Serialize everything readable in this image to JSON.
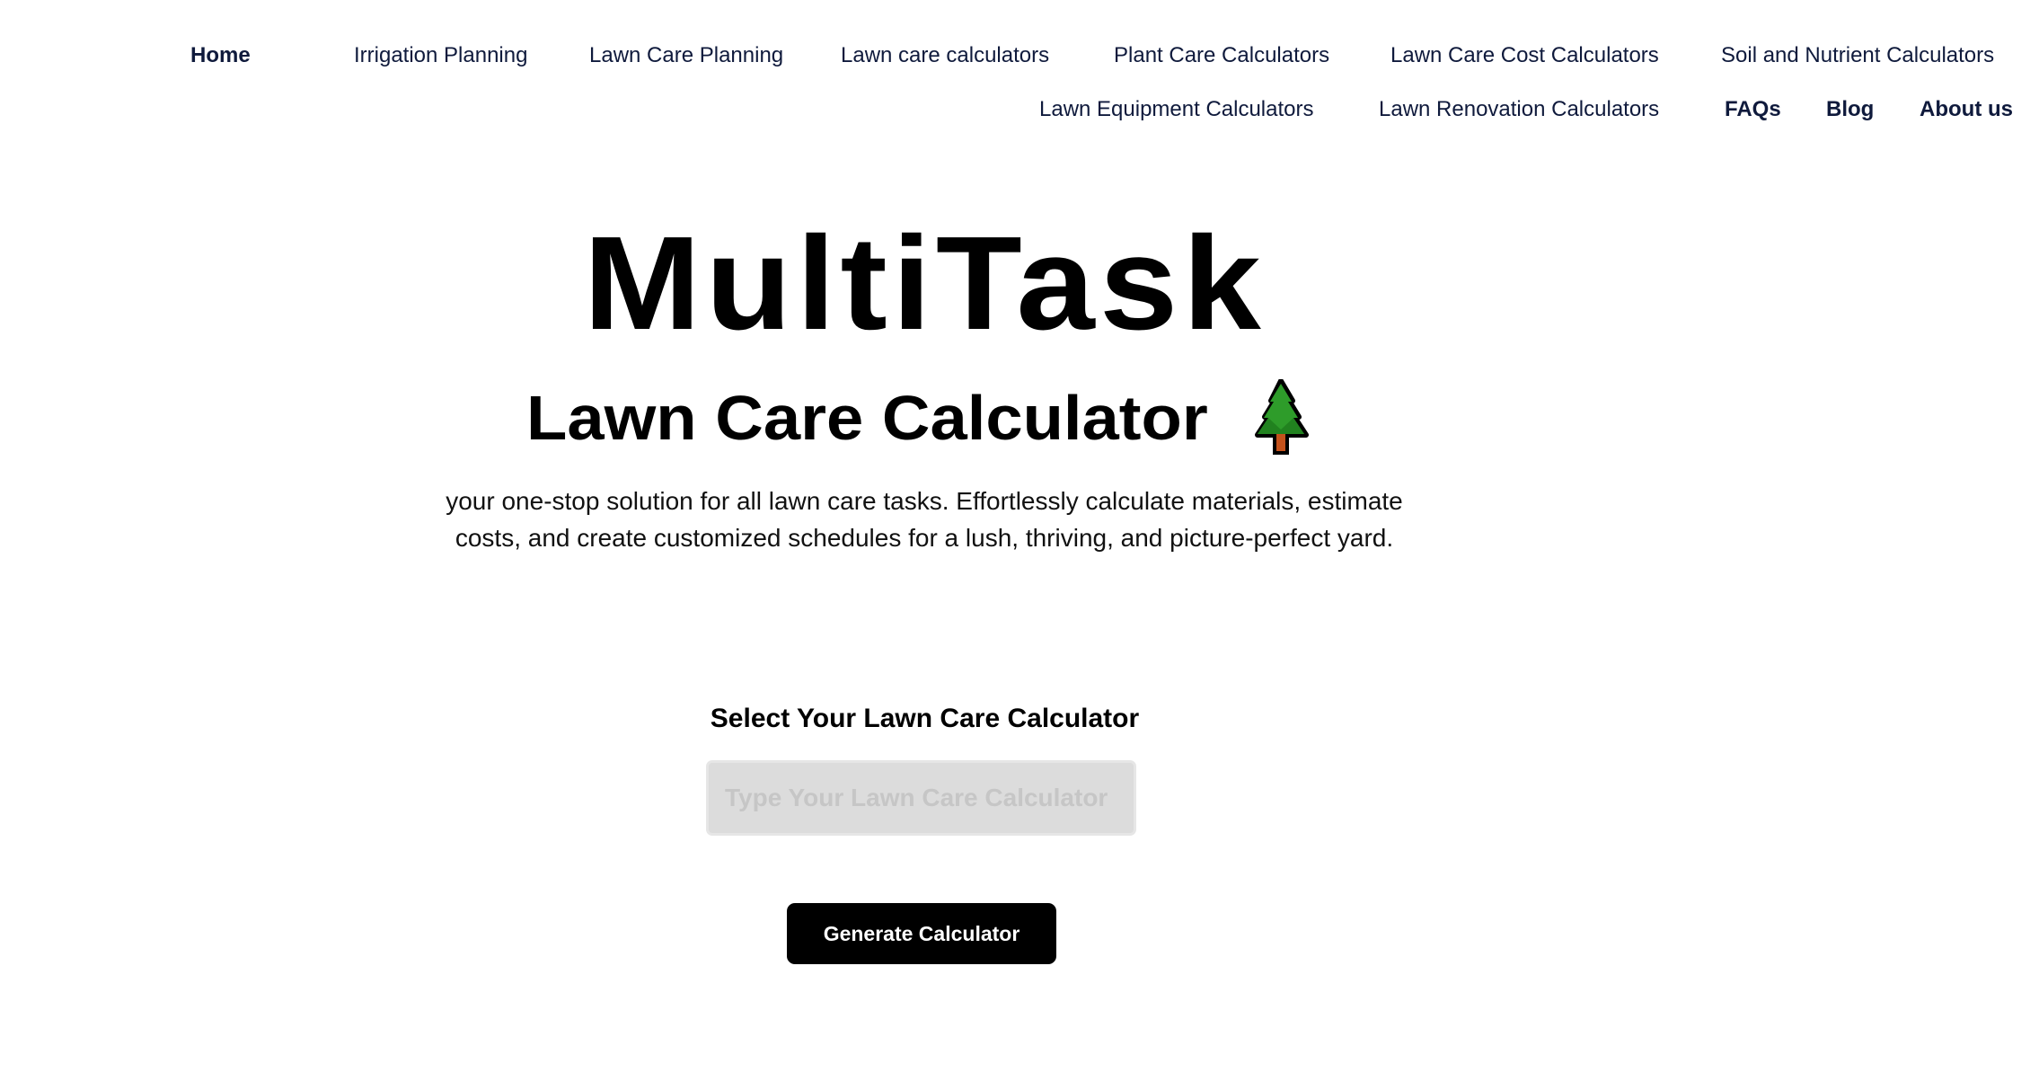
{
  "nav": {
    "row1": [
      {
        "label": "Home",
        "bold": true,
        "active": true
      },
      {
        "label": "Irrigation Planning",
        "bold": false
      },
      {
        "label": "Lawn Care Planning",
        "bold": false
      },
      {
        "label": "Lawn care calculators",
        "bold": false
      },
      {
        "label": "Plant Care Calculators",
        "bold": false
      },
      {
        "label": "Lawn Care Cost Calculators",
        "bold": false
      },
      {
        "label": "Soil and Nutrient Calculators",
        "bold": false
      }
    ],
    "row2": [
      {
        "label": "Lawn Equipment Calculators",
        "bold": false
      },
      {
        "label": "Lawn Renovation Calculators",
        "bold": false
      },
      {
        "label": "FAQs",
        "bold": true
      },
      {
        "label": "Blog",
        "bold": true
      },
      {
        "label": "About us",
        "bold": true
      }
    ],
    "text_color": "#0f1a3c"
  },
  "hero": {
    "title": "MultiTask",
    "subtitle": "Lawn Care Calculator",
    "subtitle_icon": "evergreen-tree-icon",
    "description": "your one-stop solution for all lawn care tasks. Effortlessly calculate materials, estimate costs, and create customized schedules for a lush, thriving, and picture-perfect yard."
  },
  "calculator_form": {
    "heading": "Select Your Lawn Care Calculator",
    "input_value": "",
    "input_placeholder": "Type Your Lawn Care Calculator",
    "button_label": "Generate Calculator"
  },
  "colors": {
    "button_bg": "#000000",
    "button_text": "#ffffff",
    "input_bg": "#dcdcdc",
    "placeholder": "#c6c6c6",
    "tree_green": "#2e9c2a",
    "tree_trunk": "#c4521c"
  }
}
